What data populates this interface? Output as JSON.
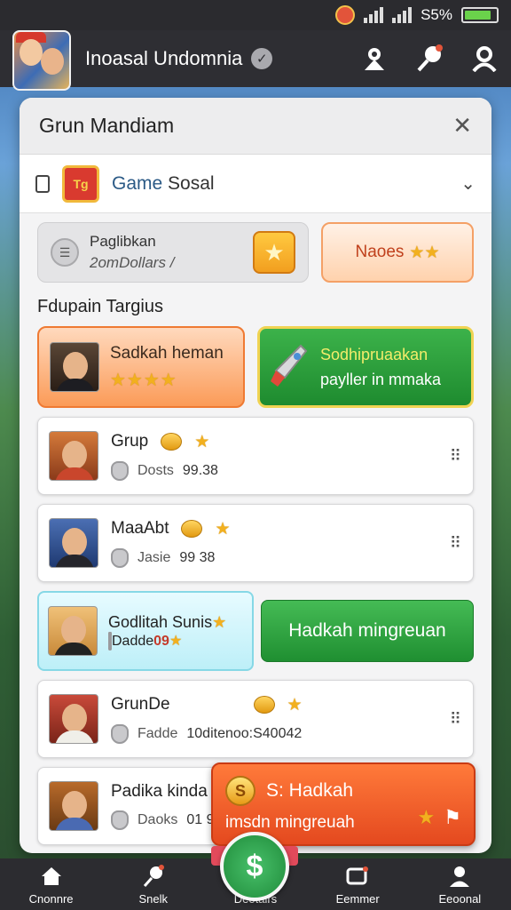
{
  "status_bar": {
    "battery_text": "S5%",
    "battery_level": 0.85
  },
  "header": {
    "title": "Inoasal Undomnia"
  },
  "card": {
    "title": "Grun Mandiam",
    "game": {
      "name_part1": "Game",
      "name_part2": "Sosal",
      "logo_text": "Tg"
    },
    "top_gray": {
      "line1": "Paglibkan",
      "line2": "2omDollars /"
    },
    "top_orange": {
      "label": "Naoes"
    },
    "section_title": "Fdupain Targius",
    "feature_left": {
      "name": "Sadkah heman",
      "stars": "★★★★"
    },
    "feature_right": {
      "line1": "Sodhipruaakan",
      "line2": "payller in mmaka"
    },
    "list": [
      {
        "name": "Grup",
        "sub_label": "Dosts",
        "sub_value": "99.38"
      },
      {
        "name": "MaaAbt",
        "sub_label": "Jasie",
        "sub_value": "99 38"
      },
      {
        "name": "Godlitah Sunis",
        "sub_label": "Dadde",
        "sub_value": "09",
        "button": "Hadkah mingreuan"
      },
      {
        "name": "GrunDe",
        "sub_label": "Fadde",
        "sub_value": "10ditenoo:S40042"
      },
      {
        "name": "Padika kinda",
        "sub_label": "Daoks",
        "sub_value": "01 9"
      }
    ],
    "promo": {
      "line1": "S: Hadkah",
      "line2": "imsdn mingreuah",
      "coin_symbol": "S"
    }
  },
  "bottom_nav": {
    "items": [
      "Cnonnre",
      "Snelk",
      "Deotairs",
      "Eemmer",
      "Eeoonal"
    ],
    "center_symbol": "$"
  },
  "colors": {
    "accent_green": "#1f8f31",
    "accent_orange": "#e4491f",
    "header_bg": "#2e2e33"
  }
}
